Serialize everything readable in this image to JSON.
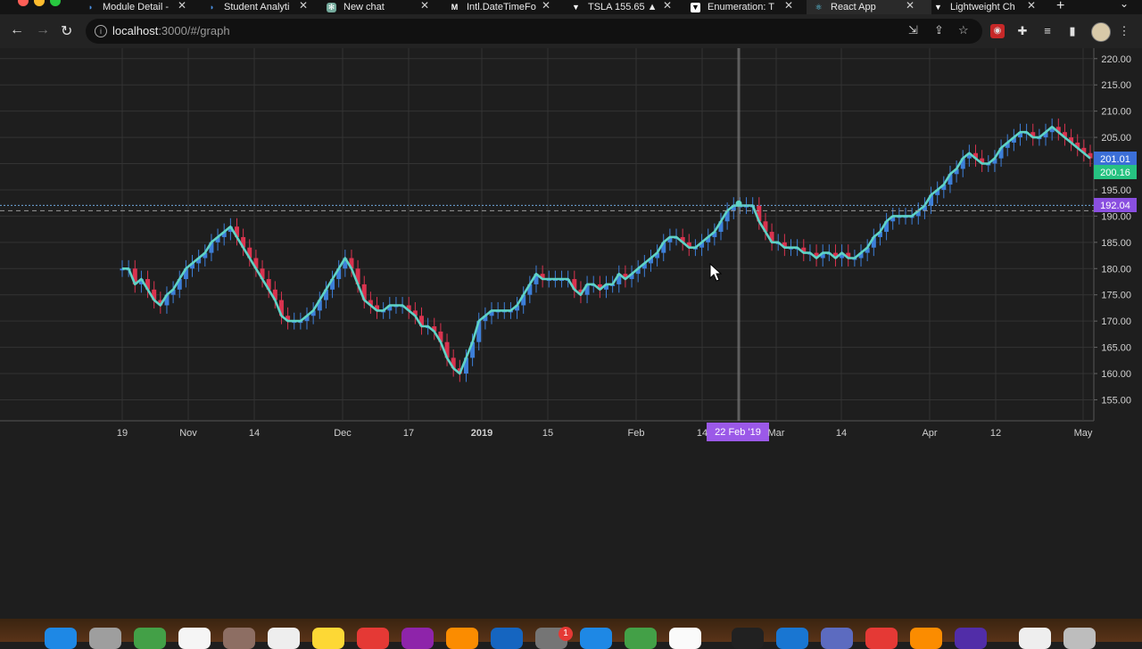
{
  "browser": {
    "tabs": [
      {
        "title": "Module Detail - ",
        "icon": "module-favicon",
        "active": false
      },
      {
        "title": "Student Analyti",
        "icon": "analytics-favicon",
        "active": false
      },
      {
        "title": "New chat",
        "icon": "chatgpt-favicon",
        "active": false
      },
      {
        "title": "Intl.DateTimeFo",
        "icon": "mdn-favicon",
        "active": false
      },
      {
        "title": "TSLA 155.65 ▲",
        "icon": "tradingview-favicon",
        "active": false
      },
      {
        "title": "Enumeration: T",
        "icon": "tradingview-favicon",
        "active": false
      },
      {
        "title": "React App",
        "icon": "react-favicon",
        "active": true
      },
      {
        "title": "Lightweight Ch",
        "icon": "tradingview-favicon",
        "active": false
      }
    ],
    "new_tab_symbol": "+",
    "tab_close_symbol": "✕",
    "url": {
      "host": "localhost",
      "rest": ":3000/#/graph"
    }
  },
  "colors": {
    "line": "#5fd3c6",
    "up_candle": "#3d7fd9",
    "down_candle": "#d9334f",
    "price_label_blue": "#3b6fd8",
    "price_label_green": "#26c281",
    "price_label_purple": "#8a4fe0",
    "crosshair_label": "#9b59e8",
    "grid": "#333333",
    "background": "#1e1e1e"
  },
  "chart_data": {
    "type": "line",
    "overlay": "candlestick",
    "y_ticks": [
      "220.00",
      "215.00",
      "210.00",
      "205.00",
      "200.00",
      "195.00",
      "190.00",
      "185.00",
      "180.00",
      "175.00",
      "170.00",
      "165.00",
      "160.00",
      "155.00"
    ],
    "y_range": [
      151,
      222
    ],
    "x_ticks": [
      {
        "label": "19",
        "bold": false
      },
      {
        "label": "Nov",
        "bold": false
      },
      {
        "label": "14",
        "bold": false
      },
      {
        "label": "Dec",
        "bold": false
      },
      {
        "label": "17",
        "bold": false
      },
      {
        "label": "2019",
        "bold": true
      },
      {
        "label": "15",
        "bold": false
      },
      {
        "label": "Feb",
        "bold": false
      },
      {
        "label": "14",
        "bold": false
      },
      {
        "label": "Mar",
        "bold": false
      },
      {
        "label": "14",
        "bold": false
      },
      {
        "label": "Apr",
        "bold": false
      },
      {
        "label": "12",
        "bold": false
      },
      {
        "label": "May",
        "bold": false
      }
    ],
    "series": [
      {
        "values": [
          180,
          180,
          177,
          178,
          176,
          174,
          173,
          175,
          176,
          178,
          180,
          181,
          182,
          183,
          185,
          186,
          187,
          188,
          186,
          184,
          182,
          180,
          178,
          176,
          174,
          171,
          170,
          170,
          170,
          171,
          172,
          174,
          176,
          178,
          180,
          182,
          180,
          177,
          174,
          173,
          172,
          172,
          173,
          173,
          173,
          172,
          171,
          169,
          169,
          168,
          166,
          163,
          161,
          160,
          163,
          166,
          170,
          171,
          172,
          172,
          172,
          172,
          173,
          175,
          177,
          179,
          178,
          178,
          178,
          178,
          178,
          176,
          175,
          177,
          177,
          176,
          177,
          177,
          179,
          178,
          179,
          180,
          181,
          182,
          183,
          185,
          186,
          186,
          185,
          184,
          184,
          185,
          186,
          187,
          189,
          191,
          192,
          192,
          192,
          192,
          189,
          187,
          185,
          185,
          184,
          184,
          184,
          183,
          183,
          182,
          183,
          183,
          182,
          183,
          182,
          182,
          183,
          184,
          186,
          187,
          189,
          190,
          190,
          190,
          190,
          191,
          192,
          194,
          195,
          196,
          198,
          199,
          201,
          202,
          201,
          200,
          200,
          201,
          203,
          204,
          205,
          206,
          206,
          205,
          205,
          206,
          207,
          206,
          205,
          204,
          203,
          202,
          201
        ]
      }
    ],
    "last_values": [
      "201.01",
      "200.16"
    ],
    "price_line": "192.04",
    "crosshair_date": "22 Feb '19",
    "grid": true
  },
  "dock": {
    "badge": "1",
    "icons": [
      "finder-icon",
      "launchpad-icon",
      "messages-icon",
      "calendar-icon",
      "contacts-icon",
      "reminders-icon",
      "notes-icon",
      "music-icon",
      "podcasts-icon",
      "pages-icon",
      "xcode-icon",
      "system-preferences-icon",
      "testflight-icon",
      "numbers-icon",
      "chrome-icon",
      "terminal-icon",
      "vscode-icon",
      "teams-icon",
      "anydesk-icon",
      "pencil-app-icon",
      "imovie-icon",
      "preview-icon",
      "trash-icon"
    ]
  }
}
